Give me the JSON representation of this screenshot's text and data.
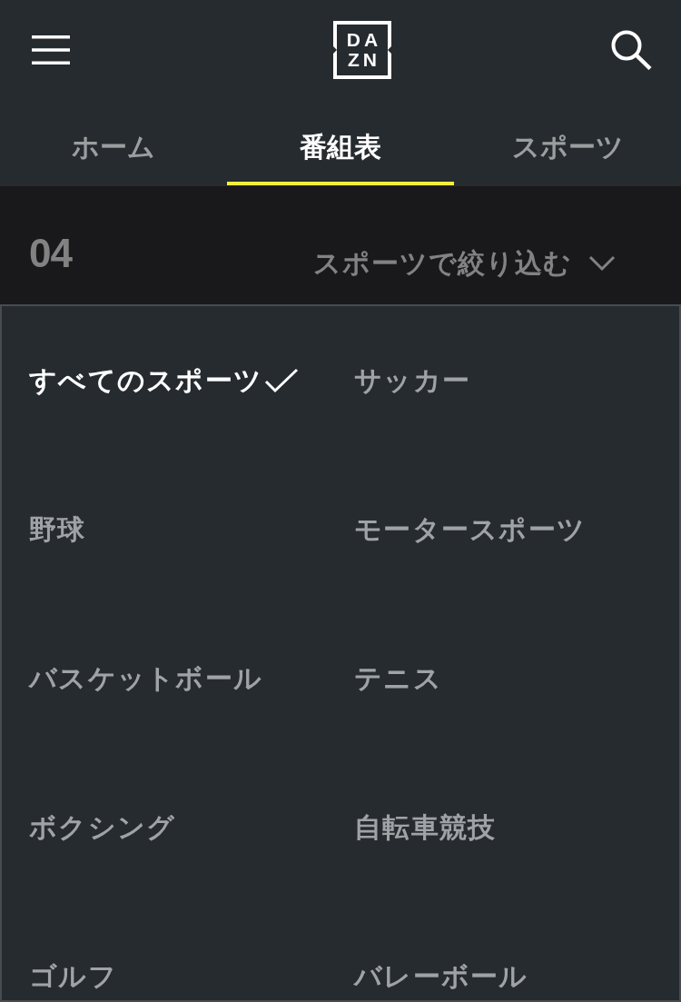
{
  "header": {
    "logo": {
      "lines": [
        "DA",
        "ZN"
      ]
    }
  },
  "tabs": [
    {
      "label": "ホーム",
      "selected": false
    },
    {
      "label": "番組表",
      "selected": true
    },
    {
      "label": "スポーツ",
      "selected": false
    }
  ],
  "date_bar": {
    "date": "04",
    "filter": {
      "label": "スポーツで絞り込む",
      "expanded": true
    }
  },
  "sport_menu": {
    "items": [
      {
        "label": "すべてのスポーツ",
        "selected": true
      },
      {
        "label": "サッカー",
        "selected": false
      },
      {
        "label": "野球",
        "selected": false
      },
      {
        "label": "モータースポーツ",
        "selected": false
      },
      {
        "label": "バスケットボール",
        "selected": false
      },
      {
        "label": "テニス",
        "selected": false
      },
      {
        "label": "ボクシング",
        "selected": false
      },
      {
        "label": "自転車競技",
        "selected": false
      },
      {
        "label": "ゴルフ",
        "selected": false
      },
      {
        "label": "バレーボール",
        "selected": false
      }
    ]
  }
}
